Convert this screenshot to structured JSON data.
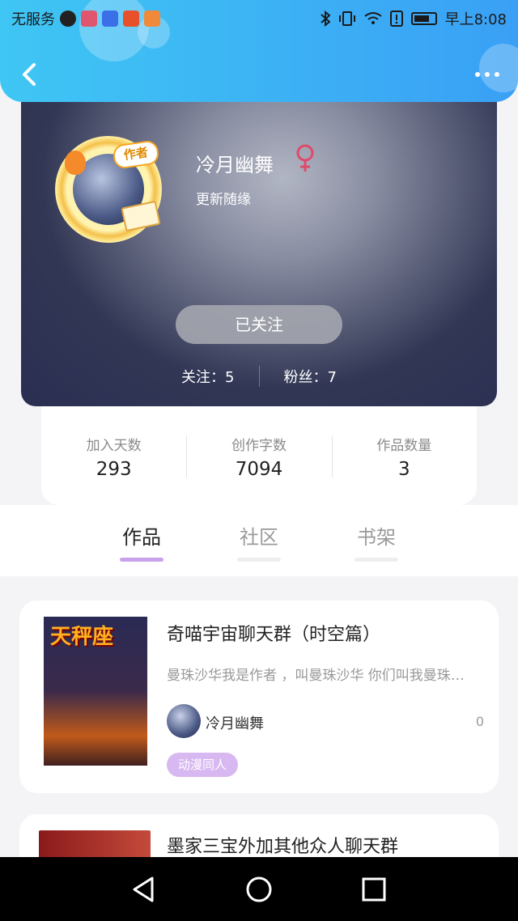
{
  "status_bar": {
    "carrier": "无服务",
    "time": "早上8:08"
  },
  "profile": {
    "author_badge": "作者",
    "name": "冷月幽舞",
    "bio": "更新随缘",
    "follow_button": "已关注",
    "following_text": "关注：5",
    "followers_text": "粉丝：7"
  },
  "metrics": [
    {
      "label": "加入天数",
      "value": "293"
    },
    {
      "label": "创作字数",
      "value": "7094"
    },
    {
      "label": "作品数量",
      "value": "3"
    }
  ],
  "tabs": [
    {
      "label": "作品",
      "active": true
    },
    {
      "label": "社区",
      "active": false
    },
    {
      "label": "书架",
      "active": false
    }
  ],
  "books": [
    {
      "title": "奇喵宇宙聊天群（时空篇）",
      "cover_text": "天秤座",
      "description": "曼珠沙华我是作者 ，叫曼珠沙华 你们叫我曼珠沙华就好",
      "author": "冷月幽舞",
      "count": "0",
      "genre": "动漫同人"
    },
    {
      "title": "墨家三宝外加其他众人聊天群"
    }
  ],
  "colors": {
    "header_start": "#3fc6f4",
    "header_end": "#3aa0f5",
    "accent_purple": "#c8a2ec",
    "gender_icon": "#e04a6a"
  }
}
